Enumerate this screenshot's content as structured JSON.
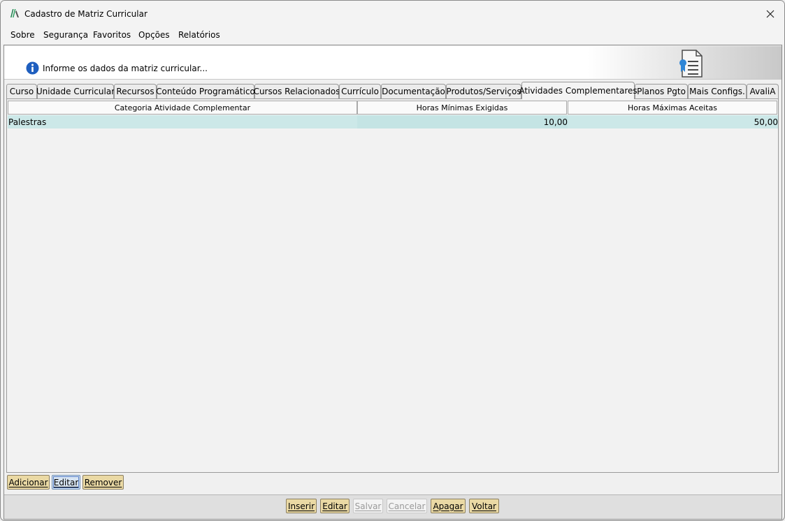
{
  "window": {
    "title": "Cadastro de Matriz Curricular"
  },
  "menu": [
    {
      "label": "Sobre"
    },
    {
      "label": "Segurança"
    },
    {
      "label": "Favoritos"
    },
    {
      "label": "Opções"
    },
    {
      "label": "Relatórios"
    }
  ],
  "header": {
    "info_text": "Informe os dados da matriz curricular..."
  },
  "tabs": [
    {
      "label": "Curso"
    },
    {
      "label": "Unidade Curricular"
    },
    {
      "label": "Recursos"
    },
    {
      "label": "Conteúdo Programático"
    },
    {
      "label": "Cursos Relacionados"
    },
    {
      "label": "Currículo"
    },
    {
      "label": "Documentação"
    },
    {
      "label": "Produtos/Serviços"
    },
    {
      "label": "Atividades Complementares",
      "active": true
    },
    {
      "label": "Planos Pgto"
    },
    {
      "label": "Mais Configs."
    },
    {
      "label": "AvaliA"
    }
  ],
  "table": {
    "columns": [
      "Categoria Atividade Complementar",
      "Horas Mínimas Exigidas",
      "Horas Máximas Aceitas"
    ],
    "rows": [
      {
        "categoria": "Palestras",
        "min": "10,00",
        "max": "50,00"
      }
    ]
  },
  "table_buttons": {
    "add": "Adicionar",
    "edit": "Editar",
    "remove": "Remover"
  },
  "footer_buttons": {
    "insert": "Inserir",
    "edit": "Editar",
    "save": "Salvar",
    "cancel": "Cancelar",
    "delete": "Apagar",
    "back": "Voltar"
  },
  "colors": {
    "selected_row": "#cce8e8",
    "button_bg": "#ead9a4",
    "info_blue": "#1f5fbf"
  }
}
